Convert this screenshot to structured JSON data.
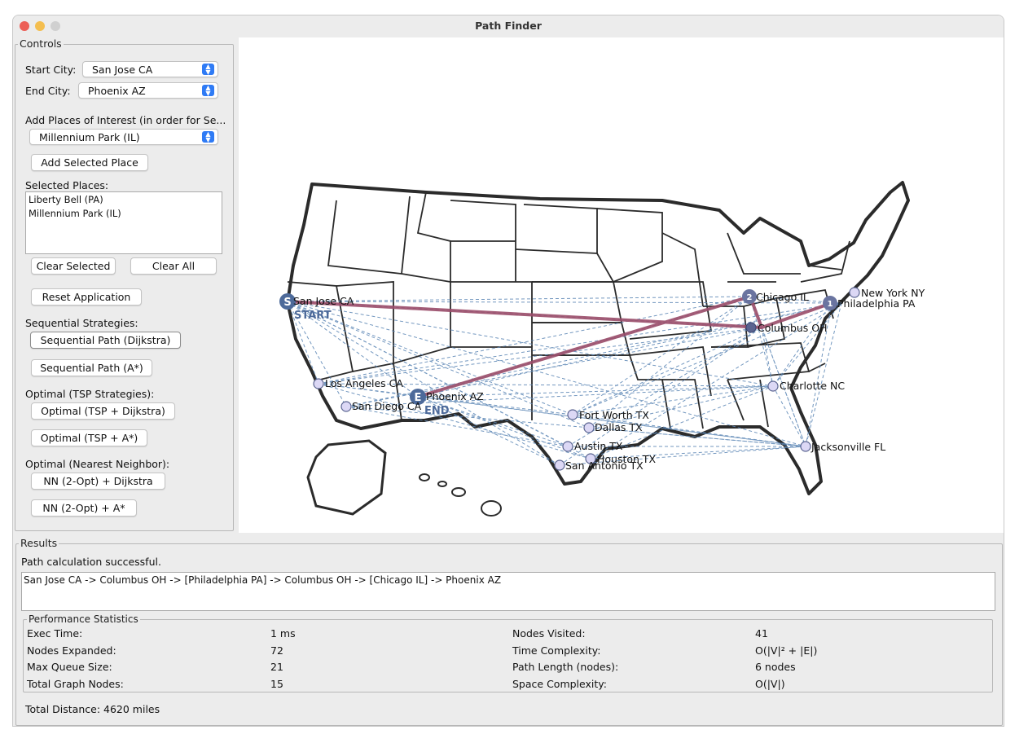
{
  "window": {
    "title": "Path Finder",
    "traffic_lights": {
      "close": "#ec5f57",
      "minimize": "#f4be4f",
      "maximize": "#d0d0d0"
    }
  },
  "controls": {
    "group_title": "Controls",
    "start_city_label": "Start City:",
    "start_city_value": "San Jose CA",
    "end_city_label": "End City:",
    "end_city_value": "Phoenix AZ",
    "places_label": "Add Places of Interest (in order for Se...",
    "places_value": "Millennium Park (IL)",
    "add_place_button": "Add Selected Place",
    "selected_places_label": "Selected Places:",
    "selected_places": [
      "Liberty Bell (PA)",
      "Millennium Park (IL)"
    ],
    "clear_selected_button": "Clear Selected",
    "clear_all_button": "Clear All",
    "reset_button": "Reset Application",
    "sequential_heading": "Sequential Strategies:",
    "seq_dijkstra_button": "Sequential Path (Dijkstra)",
    "seq_astar_button": "Sequential Path (A*)",
    "optimal_tsp_heading": "Optimal (TSP Strategies):",
    "tsp_dijkstra_button": "Optimal (TSP + Dijkstra)",
    "tsp_astar_button": "Optimal (TSP + A*)",
    "nn_heading": "Optimal (Nearest Neighbor):",
    "nn_dijkstra_button": "NN (2-Opt) + Dijkstra",
    "nn_astar_button": "NN (2-Opt) + A*"
  },
  "map": {
    "accent_route": "#9b4d6a",
    "edge_color": "#5b86b5",
    "marker_fill": "#dcd8f5",
    "marker_dark": "#5a6490",
    "start_marker": "S",
    "start_tag": "START",
    "end_marker": "E",
    "end_tag": "END",
    "stop_1": "1",
    "stop_2": "2",
    "cities": {
      "san_jose": "San Jose CA",
      "los_angeles": "Los Angeles CA",
      "san_diego": "San Diego CA",
      "phoenix": "Phoenix AZ",
      "fort_worth": "Fort Worth TX",
      "dallas": "Dallas TX",
      "austin": "Austin TX",
      "houston": "Houston TX",
      "san_antonio": "San Antonio TX",
      "chicago": "Chicago IL",
      "columbus": "Columbus OH",
      "philadelphia": "Philadelphia PA",
      "new_york": "New York NY",
      "charlotte": "Charlotte NC",
      "jacksonville": "Jacksonville FL"
    }
  },
  "results": {
    "group_title": "Results",
    "status": "Path calculation successful.",
    "path": "San Jose CA -> Columbus OH -> [Philadelphia PA] -> Columbus OH -> [Chicago IL] -> Phoenix AZ",
    "stats_title": "Performance Statistics",
    "stats": [
      {
        "label": "Exec Time:",
        "value": "1 ms"
      },
      {
        "label": "Nodes Expanded:",
        "value": "72"
      },
      {
        "label": "Max Queue Size:",
        "value": "21"
      },
      {
        "label": "Total Graph Nodes:",
        "value": "15"
      },
      {
        "label": "Nodes Visited:",
        "value": "41"
      },
      {
        "label": "Time Complexity:",
        "value": "O(|V|² + |E|)"
      },
      {
        "label": "Path Length (nodes):",
        "value": "6 nodes"
      },
      {
        "label": "Space Complexity:",
        "value": "O(|V|)"
      }
    ],
    "total_distance": "Total Distance: 4620 miles"
  }
}
